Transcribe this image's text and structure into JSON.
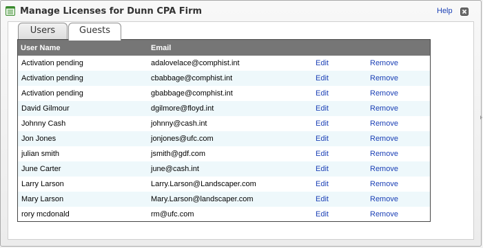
{
  "window": {
    "title": "Manage Licenses for Dunn CPA Firm",
    "help_label": "Help",
    "title_icon": "list-window-icon",
    "close_icon": "close-icon"
  },
  "tabs": [
    {
      "label": "Users",
      "active": false
    },
    {
      "label": "Guests",
      "active": true
    }
  ],
  "table": {
    "headers": {
      "user_name": "User Name",
      "email": "Email"
    },
    "action_edit": "Edit",
    "action_remove": "Remove",
    "rows": [
      {
        "name": "Activation pending",
        "email": "adalovelace@comphist.int"
      },
      {
        "name": "Activation pending",
        "email": "cbabbage@comphist.int"
      },
      {
        "name": "Activation pending",
        "email": "gbabbage@comphist.int"
      },
      {
        "name": "David Gilmour",
        "email": "dgilmore@floyd.int"
      },
      {
        "name": "Johnny Cash",
        "email": "johnny@cash.int"
      },
      {
        "name": "Jon Jones",
        "email": "jonjones@ufc.com"
      },
      {
        "name": "julian smith",
        "email": "jsmith@gdf.com"
      },
      {
        "name": "June Carter",
        "email": "june@cash.int"
      },
      {
        "name": "Larry Larson",
        "email": "Larry.Larson@Landscaper.com"
      },
      {
        "name": "Mary Larson",
        "email": "Mary.Larson@landscaper.com"
      },
      {
        "name": "rory mcdonald",
        "email": "rm@ufc.com"
      }
    ]
  },
  "colors": {
    "header_bg": "#767676",
    "alt_row_bg": "#eef8fb",
    "link": "#1a3fb5"
  }
}
